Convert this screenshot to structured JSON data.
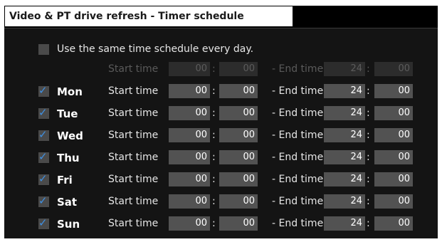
{
  "title": "Video & PT drive refresh - Timer schedule",
  "same_schedule": {
    "label": "Use the same time schedule every day.",
    "checked": false,
    "start_label": "Start time",
    "end_label": "- End time",
    "start_hour": "00",
    "start_min": "00",
    "end_hour": "24",
    "end_min": "00"
  },
  "colon": ":",
  "check_glyph": "✓",
  "days": [
    {
      "name": "Mon",
      "checked": true,
      "start_label": "Start time",
      "end_label": "- End time",
      "start_hour": "00",
      "start_min": "00",
      "end_hour": "24",
      "end_min": "00"
    },
    {
      "name": "Tue",
      "checked": true,
      "start_label": "Start time",
      "end_label": "- End time",
      "start_hour": "00",
      "start_min": "00",
      "end_hour": "24",
      "end_min": "00"
    },
    {
      "name": "Wed",
      "checked": true,
      "start_label": "Start time",
      "end_label": "- End time",
      "start_hour": "00",
      "start_min": "00",
      "end_hour": "24",
      "end_min": "00"
    },
    {
      "name": "Thu",
      "checked": true,
      "start_label": "Start time",
      "end_label": "- End time",
      "start_hour": "00",
      "start_min": "00",
      "end_hour": "24",
      "end_min": "00"
    },
    {
      "name": "Fri",
      "checked": true,
      "start_label": "Start time",
      "end_label": "- End time",
      "start_hour": "00",
      "start_min": "00",
      "end_hour": "24",
      "end_min": "00"
    },
    {
      "name": "Sat",
      "checked": true,
      "start_label": "Start time",
      "end_label": "- End time",
      "start_hour": "00",
      "start_min": "00",
      "end_hour": "24",
      "end_min": "00"
    },
    {
      "name": "Sun",
      "checked": true,
      "start_label": "Start time",
      "end_label": "- End time",
      "start_hour": "00",
      "start_min": "00",
      "end_hour": "24",
      "end_min": "00"
    }
  ],
  "colors": {
    "check_accent": "#3f8fe0",
    "panel_bg": "#141414",
    "field_bg": "#525252"
  }
}
